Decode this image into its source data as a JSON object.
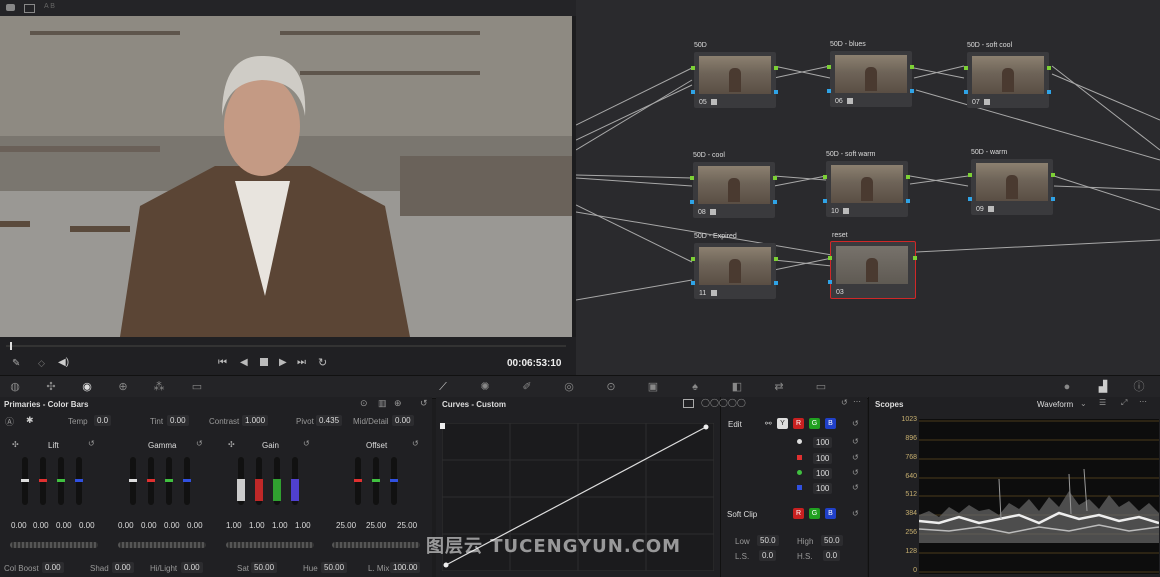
{
  "viewer": {
    "top_label": "A  B",
    "timecode": "00:06:53:10"
  },
  "nodes": [
    {
      "label": "50D",
      "id": "05"
    },
    {
      "label": "50D - blues",
      "id": "06"
    },
    {
      "label": "50D - soft cool",
      "id": "07"
    },
    {
      "label": "50D - cool",
      "id": "08"
    },
    {
      "label": "50D - soft warm",
      "id": "10"
    },
    {
      "label": "50D - warm",
      "id": "09"
    },
    {
      "label": "50D - Expired",
      "id": "11"
    },
    {
      "label": "reset",
      "id": "03"
    }
  ],
  "primaries": {
    "title": "Primaries - Color Bars",
    "temp_label": "Temp",
    "temp": "0.0",
    "tint_label": "Tint",
    "tint": "0.00",
    "contrast_label": "Contrast",
    "contrast": "1.000",
    "pivot_label": "Pivot",
    "pivot": "0.435",
    "middetail_label": "Mid/Detail",
    "middetail": "0.00",
    "wheels": [
      {
        "name": "Lift",
        "values": [
          "0.00",
          "0.00",
          "0.00",
          "0.00"
        ]
      },
      {
        "name": "Gamma",
        "values": [
          "0.00",
          "0.00",
          "0.00",
          "0.00"
        ]
      },
      {
        "name": "Gain",
        "values": [
          "1.00",
          "1.00",
          "1.00",
          "1.00"
        ]
      },
      {
        "name": "Offset",
        "values": [
          "25.00",
          "25.00",
          "25.00"
        ]
      }
    ],
    "bottom": [
      {
        "label": "Col Boost",
        "value": "0.00"
      },
      {
        "label": "Shad",
        "value": "0.00"
      },
      {
        "label": "Hi/Light",
        "value": "0.00"
      },
      {
        "label": "Sat",
        "value": "50.00"
      },
      {
        "label": "Hue",
        "value": "50.00"
      },
      {
        "label": "L. Mix",
        "value": "100.00"
      }
    ]
  },
  "curves": {
    "title": "Curves - Custom",
    "edit_label": "Edit",
    "channels": [
      "Y",
      "R",
      "G",
      "B"
    ],
    "intensities": [
      "100",
      "100",
      "100",
      "100"
    ],
    "soft_clip_label": "Soft Clip",
    "low_label": "Low",
    "low": "50.0",
    "high_label": "High",
    "high": "50.0",
    "ls_label": "L.S.",
    "ls": "0.0",
    "hs_label": "H.S.",
    "hs": "0.0"
  },
  "scopes": {
    "title": "Scopes",
    "mode": "Waveform",
    "ticks": [
      "1023",
      "896",
      "768",
      "640",
      "512",
      "384",
      "256",
      "128",
      "0"
    ]
  },
  "watermark": "图层云 TUCENGYUN.COM",
  "colors": {
    "green": "#7cd035",
    "blue": "#2fa3e6",
    "red": "#e03030",
    "accent": "#c9a24a"
  }
}
